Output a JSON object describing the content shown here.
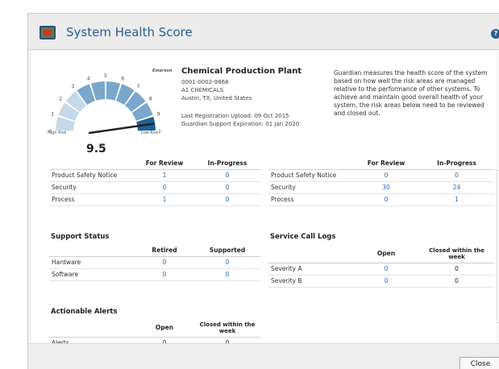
{
  "dialog": {
    "title": "System Health Score",
    "help_icon": "help-icon",
    "close_label": "Close"
  },
  "gauge": {
    "score": "9.5",
    "score_value": 9.5,
    "high_risk_label": "High Risk",
    "low_risk_label": "Low Risk",
    "ticks": [
      "0",
      "1",
      "2",
      "3",
      "4",
      "5",
      "6",
      "7",
      "8",
      "9",
      "10"
    ],
    "colors": {
      "light": "#c5d9ea",
      "mid": "#7aa7cc",
      "dark": "#1f5f99",
      "needle": "#222222"
    }
  },
  "plant": {
    "logo_text": "Emerson",
    "name": "Chemical Production Plant",
    "id": "0001-0002-9868",
    "company": "A1 CHEMICALS",
    "location": "Austin, TX, United States",
    "last_upload": "Last Registration Upload: 09 Oct 2015",
    "support_expiration": "Guardian Support Expiration: 01 Jan 2020"
  },
  "description": "Guardian measures the health score of the system based on how well the risk areas are managed relative to the performance of other systems. To achieve and maintain good overall health of your system, the risk areas below need to be reviewed and closed out.",
  "risk_left": {
    "headers": [
      "",
      "For Review",
      "In-Progress"
    ],
    "rows": [
      {
        "label": "Product Safety Notice",
        "review": "1",
        "progress": "0"
      },
      {
        "label": "Security",
        "review": "0",
        "progress": "0"
      },
      {
        "label": "Process",
        "review": "1",
        "progress": "0"
      }
    ]
  },
  "risk_right": {
    "headers": [
      "",
      "For Review",
      "In-Progress"
    ],
    "rows": [
      {
        "label": "Product Safety Notice",
        "review": "0",
        "progress": "0"
      },
      {
        "label": "Security",
        "review": "30",
        "progress": "24"
      },
      {
        "label": "Process",
        "review": "0",
        "progress": "1"
      }
    ]
  },
  "support_status": {
    "title": "Support Status",
    "headers": [
      "",
      "Retired",
      "Supported"
    ],
    "rows": [
      {
        "label": "Hardware",
        "retired": "0",
        "supported": "0"
      },
      {
        "label": "Software",
        "retired": "0",
        "supported": "0"
      }
    ]
  },
  "service_call_logs": {
    "title": "Service Call Logs",
    "headers": [
      "",
      "Open",
      "Closed within the week"
    ],
    "rows": [
      {
        "label": "Severity A",
        "open": "0",
        "closed": "0"
      },
      {
        "label": "Severity B",
        "open": "0",
        "closed": "0"
      }
    ]
  },
  "actionable_alerts": {
    "title": "Actionable Alerts",
    "headers": [
      "",
      "Open",
      "Closed within the week"
    ],
    "rows": [
      {
        "label": "Alerts",
        "open": "0",
        "closed": "0"
      }
    ]
  }
}
